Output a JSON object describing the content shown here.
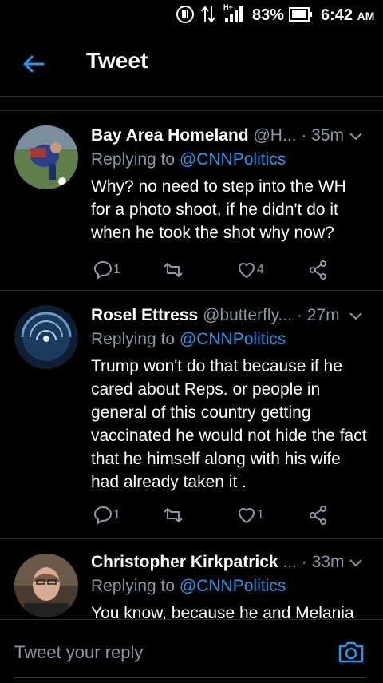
{
  "status_bar": {
    "battery": "83%",
    "time": "6:42",
    "ampm": "AM",
    "network": "H+"
  },
  "header": {
    "title": "Tweet"
  },
  "tweets": [
    {
      "name": "Bay Area Homeland",
      "handle": "@H...",
      "time": "35m",
      "replying_label": "Replying to",
      "replying_to": "@CNNPolitics",
      "text": "Why? no need to step into the WH for a photo shoot, if he didn't do it when he took the shot why now?",
      "reply_count": "1",
      "retweet_count": "",
      "like_count": "4"
    },
    {
      "name": "Rosel Ettress",
      "handle": "@butterfly...",
      "time": "27m",
      "replying_label": "Replying to",
      "replying_to": "@CNNPolitics",
      "text": "Trump won't do that because if he cared about  Reps. or people in general of this country getting vaccinated he would not hide the fact that he himself along with his wife had already taken it .",
      "reply_count": "1",
      "retweet_count": "",
      "like_count": "1"
    },
    {
      "name": "Christopher Kirkpatrick",
      "handle": "...",
      "time": "33m",
      "replying_label": "Replying to",
      "replying_to": "@CNNPolitics",
      "text": "You know, because he and Melania",
      "reply_count": "",
      "retweet_count": "",
      "like_count": ""
    }
  ],
  "composer": {
    "placeholder": "Tweet your reply"
  },
  "colors": {
    "accent": "#1d9bf0",
    "muted": "#8b98a5",
    "background": "#000000"
  }
}
